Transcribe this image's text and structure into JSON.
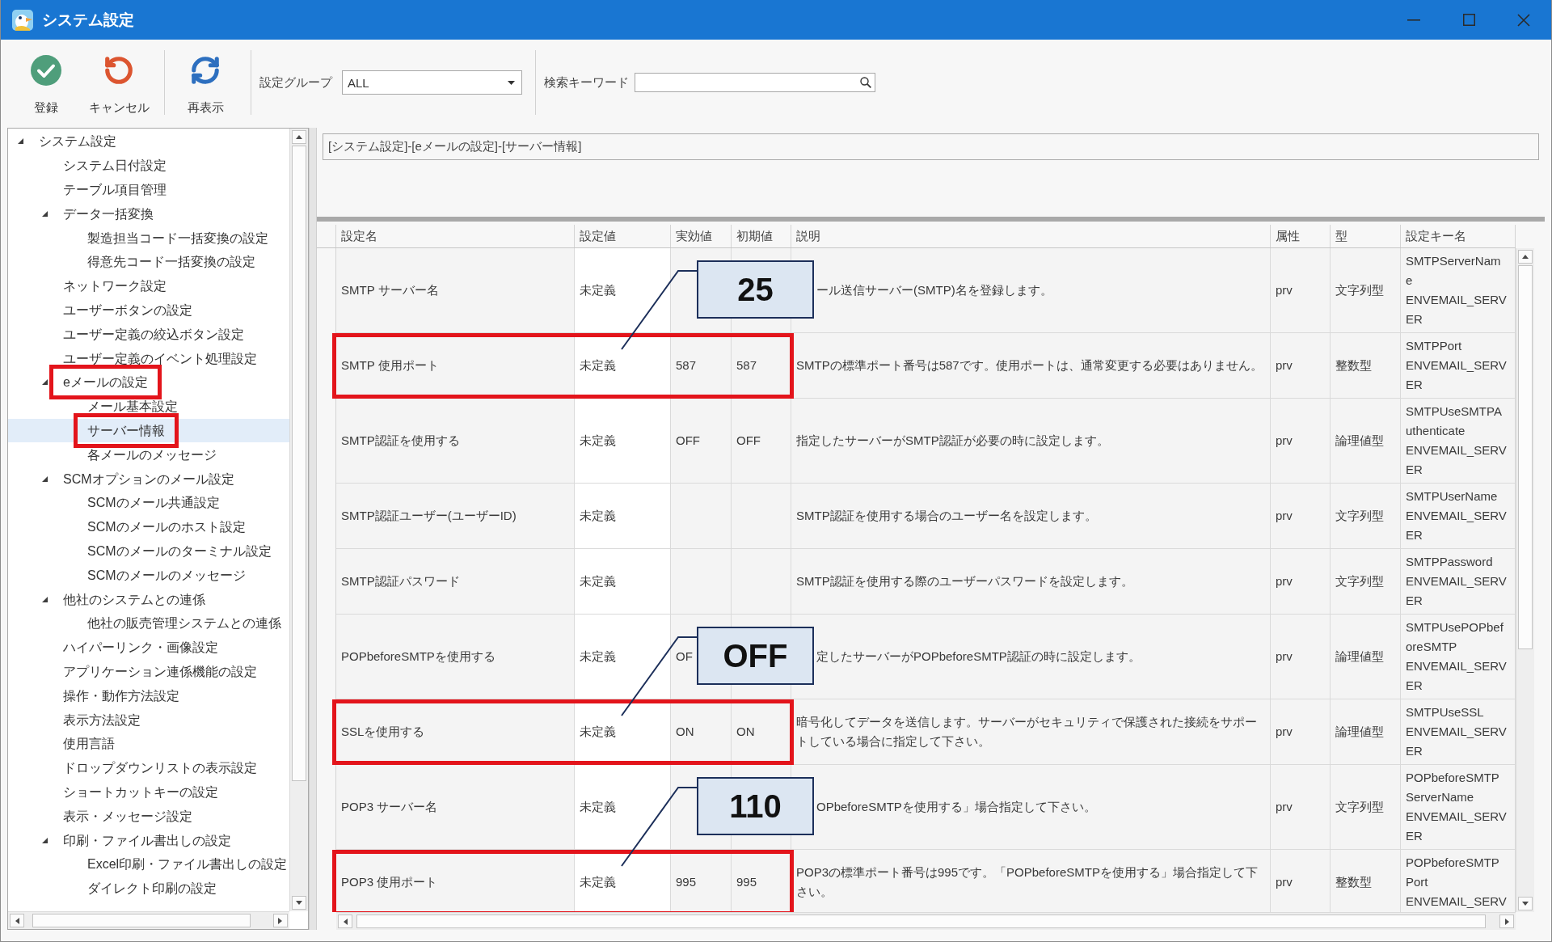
{
  "window": {
    "title": "システム設定"
  },
  "toolbar": {
    "groups": [
      {
        "buttons": [
          {
            "kind": "save",
            "label": "登録"
          },
          {
            "kind": "cancel",
            "label": "キャンセル"
          }
        ]
      },
      {
        "buttons": [
          {
            "kind": "refresh",
            "label": "再表示"
          }
        ]
      }
    ],
    "group_filter": {
      "label": "設定グループ",
      "value": "ALL"
    },
    "search": {
      "label": "検索キーワード"
    }
  },
  "tree": {
    "items": [
      {
        "label": "システム設定",
        "selected": false,
        "highlighted": false,
        "expanded": true,
        "children": [
          {
            "label": "システム日付設定",
            "selected": false,
            "highlighted": false
          },
          {
            "label": "テーブル項目管理",
            "selected": false,
            "highlighted": false
          },
          {
            "label": "データ一括変換",
            "selected": false,
            "highlighted": false,
            "expanded": true,
            "children": [
              {
                "label": "製造担当コード一括変換の設定",
                "selected": false,
                "highlighted": false
              },
              {
                "label": "得意先コード一括変換の設定",
                "selected": false,
                "highlighted": false
              }
            ]
          },
          {
            "label": "ネットワーク設定",
            "selected": false,
            "highlighted": false
          },
          {
            "label": "ユーザーボタンの設定",
            "selected": false,
            "highlighted": false
          },
          {
            "label": "ユーザー定義の絞込ボタン設定",
            "selected": false,
            "highlighted": false
          },
          {
            "label": "ユーザー定義のイベント処理設定",
            "selected": false,
            "highlighted": false
          },
          {
            "label": "eメールの設定",
            "selected": false,
            "highlighted": true,
            "expanded": true,
            "children": [
              {
                "label": "メール基本設定",
                "selected": false,
                "highlighted": false
              },
              {
                "label": "サーバー情報",
                "selected": true,
                "highlighted": true
              },
              {
                "label": "各メールのメッセージ",
                "selected": false,
                "highlighted": false
              }
            ]
          },
          {
            "label": "SCMオプションのメール設定",
            "selected": false,
            "highlighted": false,
            "expanded": true,
            "children": [
              {
                "label": "SCMのメール共通設定",
                "selected": false,
                "highlighted": false
              },
              {
                "label": "SCMのメールのホスト設定",
                "selected": false,
                "highlighted": false
              },
              {
                "label": "SCMのメールのターミナル設定",
                "selected": false,
                "highlighted": false
              },
              {
                "label": "SCMのメールのメッセージ",
                "selected": false,
                "highlighted": false
              }
            ]
          },
          {
            "label": "他社のシステムとの連係",
            "selected": false,
            "highlighted": false,
            "expanded": true,
            "children": [
              {
                "label": "他社の販売管理システムとの連係",
                "selected": false,
                "highlighted": false
              }
            ]
          },
          {
            "label": "ハイパーリンク・画像設定",
            "selected": false,
            "highlighted": false
          },
          {
            "label": "アプリケーション連係機能の設定",
            "selected": false,
            "highlighted": false
          },
          {
            "label": "操作・動作方法設定",
            "selected": false,
            "highlighted": false
          },
          {
            "label": "表示方法設定",
            "selected": false,
            "highlighted": false
          },
          {
            "label": "使用言語",
            "selected": false,
            "highlighted": false
          },
          {
            "label": "ドロップダウンリストの表示設定",
            "selected": false,
            "highlighted": false
          },
          {
            "label": "ショートカットキーの設定",
            "selected": false,
            "highlighted": false
          },
          {
            "label": "表示・メッセージ設定",
            "selected": false,
            "highlighted": false
          },
          {
            "label": "印刷・ファイル書出しの設定",
            "selected": false,
            "highlighted": false,
            "expanded": true,
            "children": [
              {
                "label": "Excel印刷・ファイル書出しの設定",
                "selected": false,
                "highlighted": false
              },
              {
                "label": "ダイレクト印刷の設定",
                "selected": false,
                "highlighted": false
              }
            ]
          }
        ]
      }
    ]
  },
  "breadcrumb": "[システム設定]-[eメールの設定]-[サーバー情報]",
  "table": {
    "columns": [
      "設定名",
      "設定値",
      "実効値",
      "初期値",
      "説明",
      "属性",
      "型",
      "設定キー名"
    ],
    "rows": [
      {
        "name": "SMTP サーバー名",
        "value": "未定義",
        "description": "ール送信サーバー(SMTP)名を登録します。",
        "attribute": "prv",
        "type": "文字列型",
        "key": "SMTPServerName\nENVEMAIL_SERVER",
        "highlighted": false
      },
      {
        "name": "SMTP 使用ポート",
        "value": "未定義",
        "effective": "587",
        "initial": "587",
        "description": "SMTPの標準ポート番号は587です。使用ポートは、通常変更する必要はありません。",
        "attribute": "prv",
        "type": "整数型",
        "key": "SMTPPort\nENVEMAIL_SERVER",
        "highlighted": true,
        "callout": "25"
      },
      {
        "name": "SMTP認証を使用する",
        "value": "未定義",
        "effective": "OFF",
        "initial": "OFF",
        "description": "指定したサーバーがSMTP認証が必要の時に設定します。",
        "attribute": "prv",
        "type": "論理値型",
        "key": "SMTPUseSMTPAuthenticate\nENVEMAIL_SERVER",
        "highlighted": false
      },
      {
        "name": "SMTP認証ユーザー(ユーザーID)",
        "value": "未定義",
        "description": "SMTP認証を使用する場合のユーザー名を設定します。",
        "attribute": "prv",
        "type": "文字列型",
        "key": "SMTPUserName\nENVEMAIL_SERVER",
        "highlighted": false
      },
      {
        "name": "SMTP認証パスワード",
        "value": "未定義",
        "description": "SMTP認証を使用する際のユーザーパスワードを設定します。",
        "attribute": "prv",
        "type": "文字列型",
        "key": "SMTPPassword\nENVEMAIL_SERVER",
        "highlighted": false
      },
      {
        "name": "POPbeforeSMTPを使用する",
        "value": "未定義",
        "effective": "OF",
        "description": "定したサーバーがPOPbeforeSMTP認証の時に設定します。",
        "attribute": "prv",
        "type": "論理値型",
        "key": "SMTPUsePOPbeforeSMTP\nENVEMAIL_SERVER",
        "highlighted": false
      },
      {
        "name": "SSLを使用する",
        "value": "未定義",
        "effective": "ON",
        "initial": "ON",
        "description": "暗号化してデータを送信します。サーバーがセキュリティで保護された接続をサポートしている場合に指定して下さい。",
        "attribute": "prv",
        "type": "論理値型",
        "key": "SMTPUseSSL\nENVEMAIL_SERVER",
        "highlighted": true,
        "callout": "OFF"
      },
      {
        "name": "POP3 サーバー名",
        "value": "未定義",
        "description": "OPbeforeSMTPを使用する」場合指定して下さい。",
        "attribute": "prv",
        "type": "文字列型",
        "key": "POPbeforeSMTPServerName\nENVEMAIL_SERVER",
        "highlighted": false
      },
      {
        "name": "POP3 使用ポート",
        "value": "未定義",
        "effective": "995",
        "initial": "995",
        "description": "POP3の標準ポート番号は995です。「POPbeforeSMTPを使用する」場合指定して下さい。",
        "attribute": "prv",
        "type": "整数型",
        "key": "POPbeforeSMTPPort\nENVEMAIL_SERV",
        "highlighted": true,
        "callout": "110"
      }
    ]
  }
}
